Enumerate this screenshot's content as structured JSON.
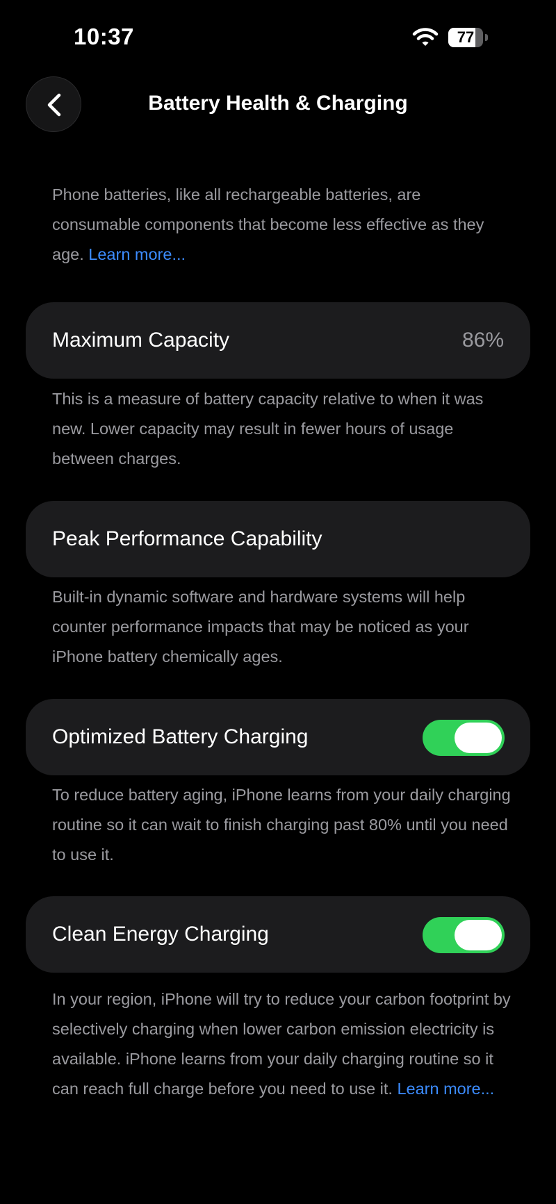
{
  "status_bar": {
    "time": "10:37",
    "battery_percent": 77,
    "battery_text": "77",
    "wifi_icon": "wifi-icon",
    "battery_icon": "battery-icon"
  },
  "nav": {
    "title": "Battery Health & Charging",
    "back_icon": "chevron-left-icon"
  },
  "intro": {
    "text": "Phone batteries, like all rechargeable batteries, are consumable components that become less effective as they age. ",
    "link": "Learn more..."
  },
  "maximum_capacity": {
    "label": "Maximum Capacity",
    "value": "86%",
    "description": "This is a measure of battery capacity relative to when it was new. Lower capacity may result in fewer hours of usage between charges."
  },
  "peak_performance": {
    "label": "Peak Performance Capability",
    "description": "Built-in dynamic software and hardware systems will help counter performance impacts that may be noticed as your iPhone battery chemically ages."
  },
  "optimized_charging": {
    "label": "Optimized Battery Charging",
    "enabled": true,
    "description": "To reduce battery aging, iPhone learns from your daily charging routine so it can wait to finish charging past 80% until you need to use it."
  },
  "clean_energy": {
    "label": "Clean Energy Charging",
    "enabled": true,
    "description": "In your region, iPhone will try to reduce your carbon footprint by selectively charging when lower carbon emission electricity is available. iPhone learns from your daily charging routine so it can reach full charge before you need to use it. ",
    "link": "Learn more..."
  },
  "colors": {
    "background": "#000000",
    "card": "#1c1c1e",
    "secondary_text": "#9a9a9f",
    "link": "#3c8cff",
    "toggle_on": "#30d158"
  }
}
